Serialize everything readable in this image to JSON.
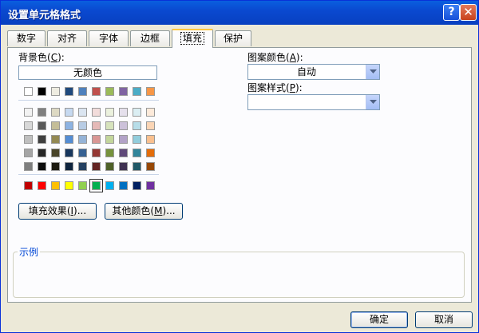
{
  "window": {
    "title": "设置单元格格式",
    "help_glyph": "?",
    "close_glyph": "✕"
  },
  "tabs": [
    {
      "label": "数字"
    },
    {
      "label": "对齐"
    },
    {
      "label": "字体"
    },
    {
      "label": "边框"
    },
    {
      "label": "填充",
      "active": true
    },
    {
      "label": "保护"
    }
  ],
  "fill": {
    "bg_label": "背景色",
    "bg_key": "C",
    "no_color_label": "无颜色",
    "fill_effects_label": "填充效果",
    "fill_effects_key": "I",
    "more_colors_label": "其他颜色",
    "more_colors_key": "M",
    "ellipsis": "..."
  },
  "theme_colors_row1": [
    "#ffffff",
    "#000000",
    "#eeece1",
    "#1f497d",
    "#4f81bd",
    "#c0504d",
    "#9bbb59",
    "#8064a2",
    "#4bacc6",
    "#f79646"
  ],
  "theme_shades": [
    [
      "#f2f2f2",
      "#808080",
      "#ddd9c3",
      "#c6d9f0",
      "#dbe5f1",
      "#f2dcdb",
      "#ebf1dd",
      "#e5e0ec",
      "#dbeef3",
      "#fdeada"
    ],
    [
      "#d8d8d8",
      "#595959",
      "#c4bd97",
      "#8db3e2",
      "#b8cce4",
      "#e5b9b7",
      "#d7e3bc",
      "#ccc1d9",
      "#b7dde8",
      "#fbd5b5"
    ],
    [
      "#bfbfbf",
      "#3f3f3f",
      "#938953",
      "#548dd4",
      "#95b3d7",
      "#d99694",
      "#c3d69b",
      "#b2a2c7",
      "#92cddc",
      "#fac08f"
    ],
    [
      "#a5a5a5",
      "#262626",
      "#494429",
      "#17365d",
      "#366092",
      "#953734",
      "#76923c",
      "#5f497a",
      "#31859b",
      "#e36c09"
    ],
    [
      "#7f7f7f",
      "#0c0c0c",
      "#1d1b10",
      "#0f243e",
      "#244061",
      "#632423",
      "#4f6128",
      "#3f3151",
      "#205867",
      "#974806"
    ]
  ],
  "standard_colors": [
    "#c00000",
    "#ff0000",
    "#ffc000",
    "#ffff00",
    "#92d050",
    "#00b050",
    "#00b0f0",
    "#0070c0",
    "#002060",
    "#7030a0"
  ],
  "selected_standard_index": 5,
  "pattern": {
    "color_label": "图案颜色",
    "color_key": "A",
    "color_value": "自动",
    "style_label": "图案样式",
    "style_key": "P",
    "style_value": ""
  },
  "sample": {
    "label": "示例"
  },
  "footer": {
    "ok_label": "确定",
    "cancel_label": "取消"
  }
}
